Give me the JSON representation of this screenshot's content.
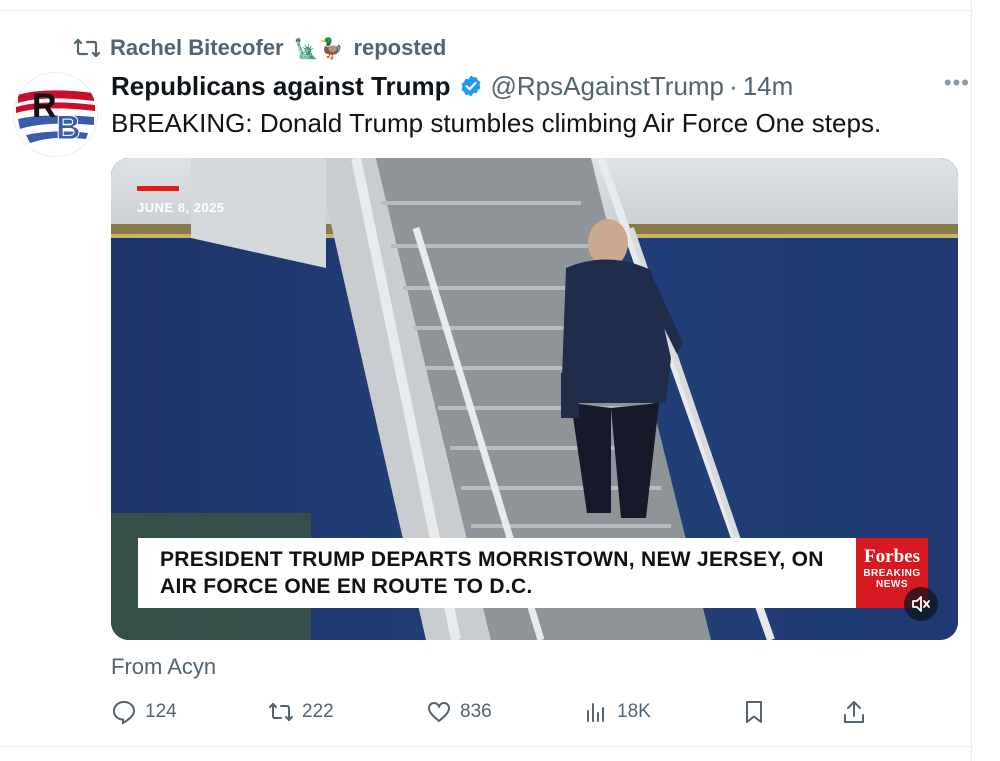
{
  "repost": {
    "user": "Rachel Bitecofer",
    "emojis": "🗽🦆",
    "suffix": "reposted"
  },
  "author": {
    "name": "Republicans against Trump",
    "handle": "@RpsAgainstTrump",
    "separator": "·",
    "time": "14m",
    "avatar_text": "RB"
  },
  "tweet": {
    "text": "BREAKING: Donald Trump stumbles climbing Air Force One steps."
  },
  "media": {
    "date_label": "JUNE 8, 2025",
    "lower_third_line1": "PRESIDENT TRUMP DEPARTS MORRISTOWN, NEW JERSEY, ON",
    "lower_third_line2": "AIR FORCE ONE EN ROUTE TO D.C.",
    "brand": "Forbes",
    "brand_sub1": "BREAKING",
    "brand_sub2": "NEWS"
  },
  "source": "From Acyn",
  "actions": {
    "replies": "124",
    "reposts": "222",
    "likes": "836",
    "views": "18K"
  },
  "colors": {
    "verified": "#1d9bf0",
    "secondary_text": "#536471",
    "forbes_red": "#d71921"
  }
}
